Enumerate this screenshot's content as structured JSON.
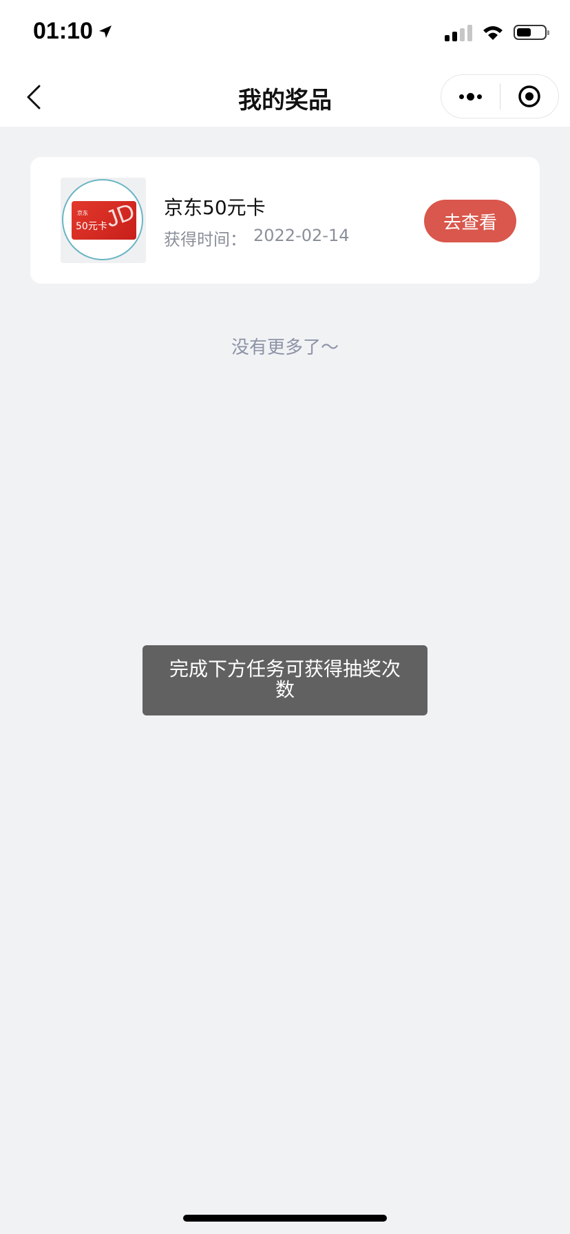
{
  "status_bar": {
    "time": "01:10",
    "icons": [
      "location-arrow-icon",
      "signal-icon",
      "wifi-icon",
      "battery-icon"
    ]
  },
  "nav": {
    "title": "我的奖品",
    "back_icon": "chevron-left-icon",
    "more_icon": "more-dots-icon",
    "close_icon": "target-circle-icon"
  },
  "prize": {
    "name": "京东50元卡",
    "time_label": "获得时间：",
    "time_value": "2022-02-14",
    "button_label": "去查看",
    "image": {
      "brand_small": "京东",
      "amount_text": "50元卡",
      "logo_text": "JD"
    }
  },
  "list_end_text": "没有更多了～",
  "toast": {
    "text": "完成下方任务可获得抽奖次数"
  },
  "colors": {
    "page_background": "#f1f2f4",
    "button": "#d9574c",
    "muted_text": "#8c93a6",
    "toast_background": "#616161"
  }
}
